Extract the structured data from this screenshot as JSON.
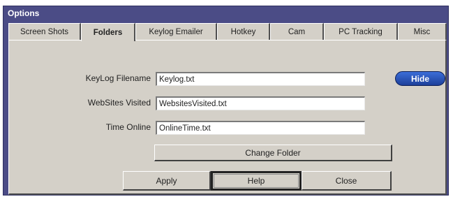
{
  "window": {
    "title": "Options"
  },
  "tabs": [
    {
      "label": "Screen Shots"
    },
    {
      "label": "Folders"
    },
    {
      "label": "Keylog Emailer"
    },
    {
      "label": "Hotkey"
    },
    {
      "label": "Cam"
    },
    {
      "label": "PC Tracking"
    },
    {
      "label": "Misc"
    }
  ],
  "active_tab": "Folders",
  "fields": {
    "keylog": {
      "label": "KeyLog Filename",
      "value": "Keylog.txt"
    },
    "websites": {
      "label": "WebSites Visited",
      "value": "WebsitesVisited.txt"
    },
    "time_online": {
      "label": "Time Online",
      "value": "OnlineTime.txt"
    }
  },
  "buttons": {
    "hide": "Hide",
    "change_folder": "Change Folder",
    "apply": "Apply",
    "help": "Help",
    "close": "Close"
  },
  "colors": {
    "title_bar": "#4b4c86",
    "panel": "#d4d0c8",
    "hide_button": "#2a55c0"
  }
}
